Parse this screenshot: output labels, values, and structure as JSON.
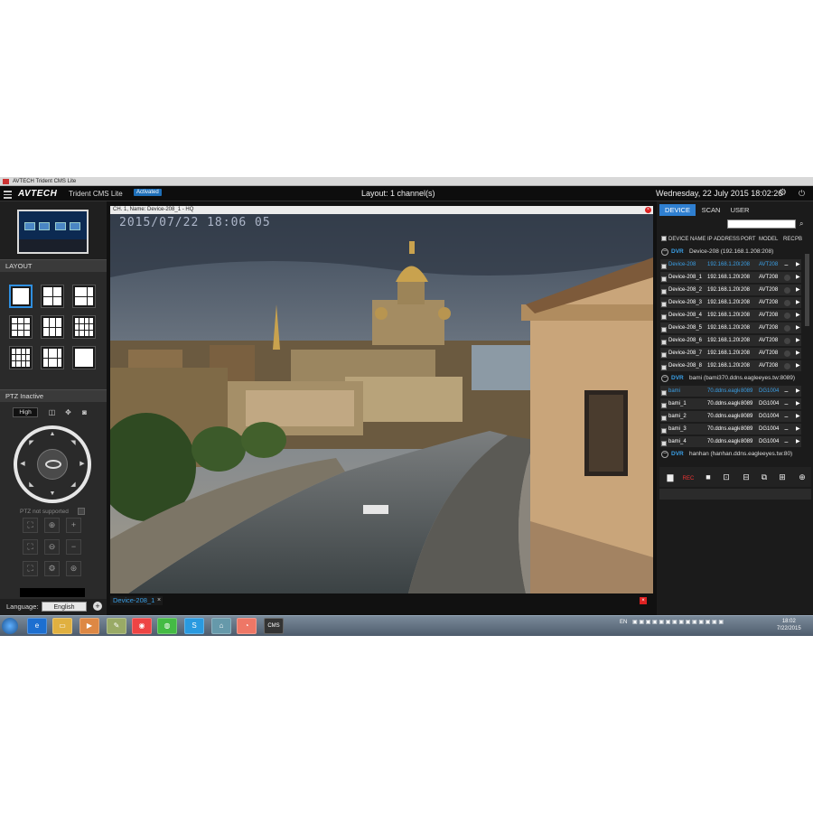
{
  "window": {
    "title": "AVTECH Trident CMS Lite"
  },
  "header": {
    "brand": "AVTECH",
    "app_name": "Trident CMS Lite",
    "badge": "Activated",
    "layout_title": "Layout: 1 channel(s)",
    "datetime": "Wednesday, 22 July 2015 18:02:26"
  },
  "left": {
    "layout_label": "LAYOUT",
    "ptz_label": "PTZ Inactive",
    "quality": "High",
    "ptz_unsupported": "PTZ not supported",
    "language_label": "Language:",
    "language_value": "English"
  },
  "video": {
    "channel_title": "CH. 1, Name: Device-208_1 - HQ",
    "osd_timestamp": "2015/07/22 18:06 05",
    "bottom_tab": "Device-208_1"
  },
  "right": {
    "tabs": [
      "DEVICE",
      "SCAN",
      "USER"
    ],
    "columns": [
      "DEVICE NAME",
      "IP ADDRESS",
      "PORT",
      "MODEL",
      "REC",
      "PB"
    ],
    "groups": [
      {
        "type": "DVR",
        "name": "Device-208",
        "address": "(192.168.1.208:208)",
        "devices": [
          {
            "name": "Device-208",
            "ip": "192.168.1.208",
            "port": "208",
            "model": "AVT208"
          },
          {
            "name": "Device-208_1",
            "ip": "192.168.1.208",
            "port": "208",
            "model": "AVT208"
          },
          {
            "name": "Device-208_2",
            "ip": "192.168.1.208",
            "port": "208",
            "model": "AVT208"
          },
          {
            "name": "Device-208_3",
            "ip": "192.168.1.208",
            "port": "208",
            "model": "AVT208"
          },
          {
            "name": "Device-208_4",
            "ip": "192.168.1.208",
            "port": "208",
            "model": "AVT208"
          },
          {
            "name": "Device-208_5",
            "ip": "192.168.1.208",
            "port": "208",
            "model": "AVT208"
          },
          {
            "name": "Device-208_6",
            "ip": "192.168.1.208",
            "port": "208",
            "model": "AVT208"
          },
          {
            "name": "Device-208_7",
            "ip": "192.168.1.208",
            "port": "208",
            "model": "AVT208"
          },
          {
            "name": "Device-208_8",
            "ip": "192.168.1.208",
            "port": "208",
            "model": "AVT208"
          }
        ]
      },
      {
        "type": "DVR",
        "name": "bami",
        "address": "(bami370.ddns.eagleeyes.tw:8089)",
        "devices": [
          {
            "name": "bami",
            "ip": "70.ddns.eaglee",
            "port": "8089",
            "model": "DG1004"
          },
          {
            "name": "bami_1",
            "ip": "70.ddns.eaglee",
            "port": "8089",
            "model": "DG1004"
          },
          {
            "name": "bami_2",
            "ip": "70.ddns.eaglee",
            "port": "8089",
            "model": "DG1004"
          },
          {
            "name": "bami_3",
            "ip": "70.ddns.eaglee",
            "port": "8089",
            "model": "DG1004"
          },
          {
            "name": "bami_4",
            "ip": "70.ddns.eaglee",
            "port": "8089",
            "model": "DG1004"
          }
        ]
      },
      {
        "type": "DVR",
        "name": "hanhan",
        "address": "(hanhan.ddns.eagleeyes.tw:80)",
        "devices": []
      }
    ],
    "rec_label": "REC"
  },
  "taskbar": {
    "lang": "EN",
    "time": "18:02",
    "date": "7/22/2015",
    "cms_label": "CMS"
  }
}
